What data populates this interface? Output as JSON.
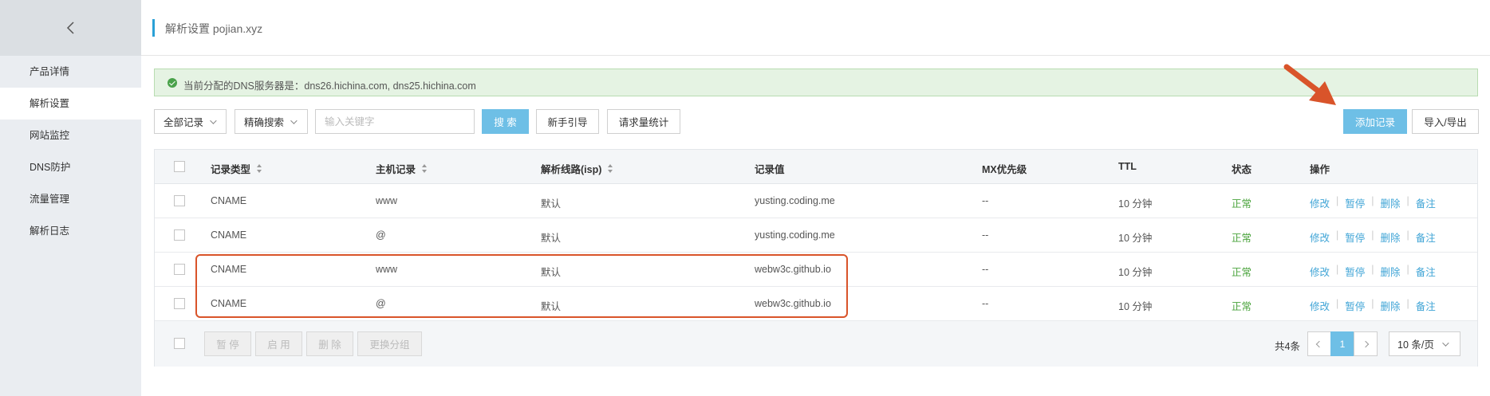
{
  "sidebar": {
    "back_icon": "chevron-left-icon",
    "items": [
      {
        "label": "产品详情",
        "active": false
      },
      {
        "label": "解析设置",
        "active": true
      },
      {
        "label": "网站监控",
        "active": false
      },
      {
        "label": "DNS防护",
        "active": false
      },
      {
        "label": "流量管理",
        "active": false
      },
      {
        "label": "解析日志",
        "active": false
      }
    ]
  },
  "header": {
    "title": "解析设置 pojian.xyz"
  },
  "notice": {
    "icon": "check-circle-icon",
    "text": "当前分配的DNS服务器是：dns26.hichina.com, dns25.hichina.com"
  },
  "toolbar": {
    "filter_all": "全部记录",
    "filter_precise": "精确搜索",
    "search_placeholder": "输入关键字",
    "search_button": "搜 索",
    "guide_button": "新手引导",
    "stats_button": "请求量统计",
    "add_button": "添加记录",
    "import_export_button": "导入/导出"
  },
  "table": {
    "columns": [
      "记录类型",
      "主机记录",
      "解析线路(isp)",
      "记录值",
      "MX优先级",
      "TTL",
      "状态",
      "操作"
    ],
    "rows": [
      {
        "type": "CNAME",
        "host": "www",
        "line": "默认",
        "value": "yusting.coding.me",
        "mx": "--",
        "ttl": "10 分钟",
        "status": "正常"
      },
      {
        "type": "CNAME",
        "host": "@",
        "line": "默认",
        "value": "yusting.coding.me",
        "mx": "--",
        "ttl": "10 分钟",
        "status": "正常"
      },
      {
        "type": "CNAME",
        "host": "www",
        "line": "默认",
        "value": "webw3c.github.io",
        "mx": "--",
        "ttl": "10 分钟",
        "status": "正常"
      },
      {
        "type": "CNAME",
        "host": "@",
        "line": "默认",
        "value": "webw3c.github.io",
        "mx": "--",
        "ttl": "10 分钟",
        "status": "正常"
      }
    ],
    "row_actions": [
      "修改",
      "暂停",
      "删除",
      "备注"
    ]
  },
  "footer": {
    "pause_button": "暂 停",
    "enable_button": "启 用",
    "delete_button": "删 除",
    "change_group_button": "更换分组",
    "total": "共4条",
    "current_page": "1",
    "page_size": "10 条/页"
  },
  "colors": {
    "accent": "#6ebfe6",
    "link": "#3fa4d6",
    "status_ok": "#4aa33c",
    "annotation": "#d9542a"
  }
}
